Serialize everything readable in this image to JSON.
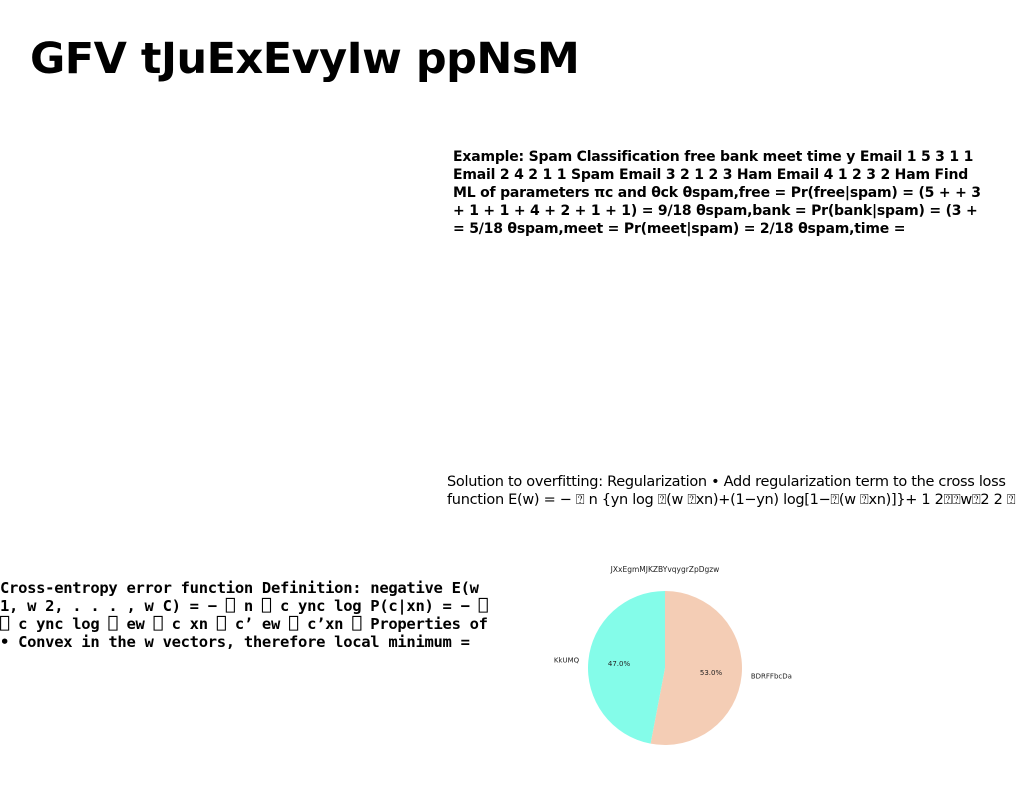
{
  "slide": {
    "title": "GFV tJuExEvyIw ppNsM",
    "spam_block": "Example: Spam Classification free bank meet time y Email 1 5 3 1 1 Email 2 4 2 1 1 Spam Email 3 2 1 2 3 Ham Email 4 1 2 3 2 Ham Find ML of parameters πc and θck θspam,free = Pr(free|spam) = (5 + + 3 + 1 + 1 + 4 + 2 + 1 + 1) = 9/18 θspam,bank = Pr(bank|spam) = (3 + = 5/18 θspam,meet = Pr(meet|spam) = 2/18 θspam,time =",
    "regularization_block": "Solution to overfitting: Regularization • Add regularization term to the cross loss function E(w) = − ⍰ n {yn log ⍰(w ⍰xn)+(1−yn) log[1−⍰(w ⍰xn)]}+ 1 2⍰⍰w⍰2 2 ⍰",
    "cross_entropy_block": "Cross-entropy error function Definition: negative E(w 1, w 2, . . . , w C) = − ⎕ n ⎕ c ync log P(c|xn) = − ⎕ ⎕ c ync log ⎕ ew ⎕ c xn ⎕ c’ ew ⎕ c’xn ⎕ Properties of • Convex in the w vectors, therefore local minimum ="
  },
  "chart_data": {
    "type": "pie",
    "title": "JXxEgmMJKZBYvqygrZpDgzw",
    "categories": [
      "BDRFFbcDa",
      "KkUMQ"
    ],
    "values": [
      53.0,
      47.0
    ],
    "value_labels": [
      "53.0%",
      "47.0%"
    ],
    "colors": [
      "#f4cdb5",
      "#84fce9"
    ],
    "start_angle_deg": 90,
    "direction": "clockwise"
  }
}
